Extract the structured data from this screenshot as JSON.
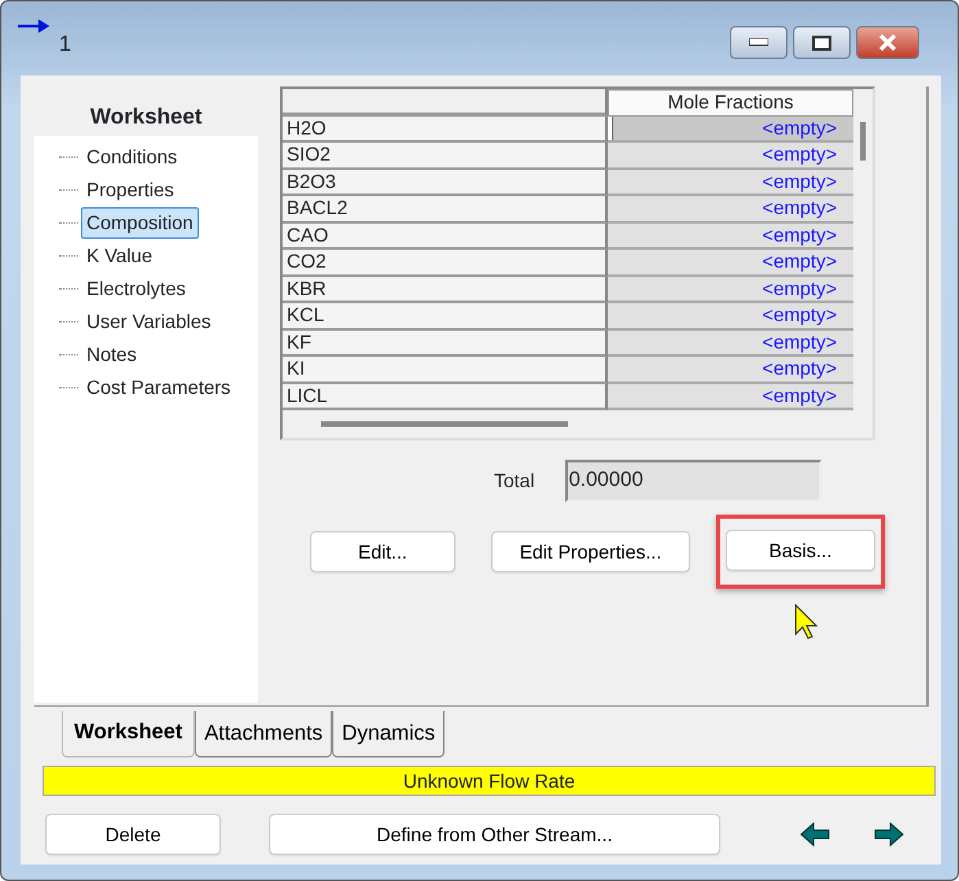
{
  "window": {
    "title": "1"
  },
  "sidebar": {
    "heading": "Worksheet",
    "items": [
      {
        "label": "Conditions",
        "selected": false
      },
      {
        "label": "Properties",
        "selected": false
      },
      {
        "label": "Composition",
        "selected": true
      },
      {
        "label": "K Value",
        "selected": false
      },
      {
        "label": "Electrolytes",
        "selected": false
      },
      {
        "label": "User Variables",
        "selected": false
      },
      {
        "label": "Notes",
        "selected": false
      },
      {
        "label": "Cost Parameters",
        "selected": false
      }
    ]
  },
  "table": {
    "columns": [
      "Mole Fractions"
    ],
    "rows": [
      {
        "component": "H2O",
        "value": "<empty>",
        "selected": true
      },
      {
        "component": "SIO2",
        "value": "<empty>",
        "selected": false
      },
      {
        "component": "B2O3",
        "value": "<empty>",
        "selected": false
      },
      {
        "component": "BACL2",
        "value": "<empty>",
        "selected": false
      },
      {
        "component": "CAO",
        "value": "<empty>",
        "selected": false
      },
      {
        "component": "CO2",
        "value": "<empty>",
        "selected": false
      },
      {
        "component": "KBR",
        "value": "<empty>",
        "selected": false
      },
      {
        "component": "KCL",
        "value": "<empty>",
        "selected": false
      },
      {
        "component": "KF",
        "value": "<empty>",
        "selected": false
      },
      {
        "component": "KI",
        "value": "<empty>",
        "selected": false
      },
      {
        "component": "LICL",
        "value": "<empty>",
        "selected": false
      }
    ]
  },
  "total": {
    "label": "Total",
    "value": "0.00000"
  },
  "buttons": [
    {
      "label": "Edit...",
      "highlighted": false
    },
    {
      "label": "Edit Properties...",
      "highlighted": false
    },
    {
      "label": "Basis...",
      "highlighted": true
    }
  ],
  "tabs": [
    {
      "label": "Worksheet",
      "selected": true
    },
    {
      "label": "Attachments",
      "selected": false
    },
    {
      "label": "Dynamics",
      "selected": false
    }
  ],
  "status_bar": "Unknown Flow Rate",
  "bottom_buttons": [
    "Delete",
    "Define from Other Stream..."
  ]
}
